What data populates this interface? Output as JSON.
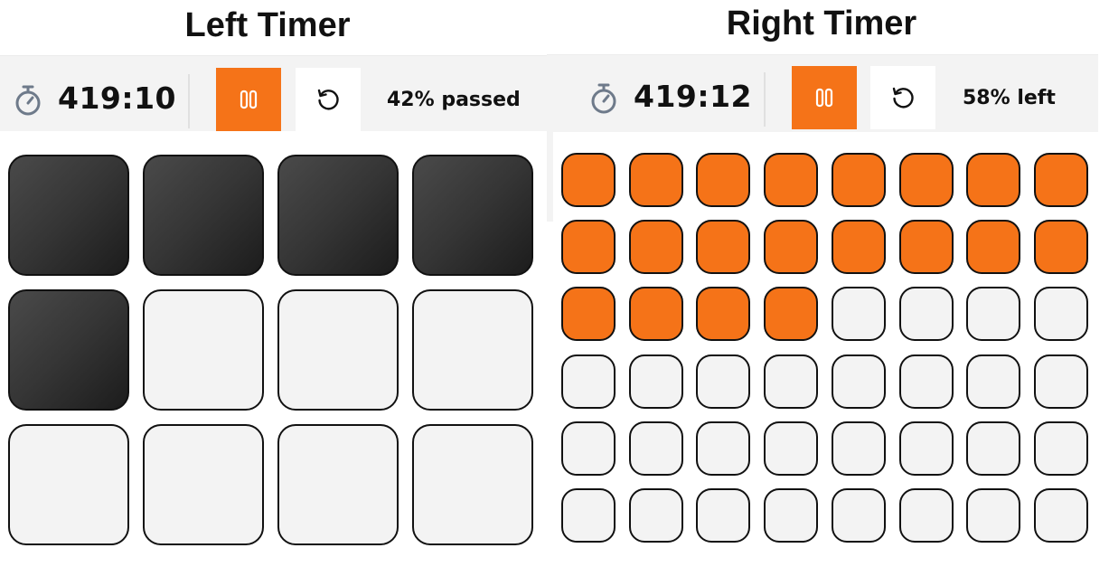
{
  "left_timer": {
    "title": "Left Timer",
    "time": "419:10",
    "status": "42% passed",
    "progress_percent": 42,
    "grid": {
      "rows": 3,
      "columns": 4,
      "total_cells": 12,
      "filled_cells": 5,
      "fill_style": "dark"
    }
  },
  "right_timer": {
    "title": "Right Timer",
    "time": "419:12",
    "status": "58% left",
    "progress_percent_left": 58,
    "grid": {
      "rows": 6,
      "columns": 8,
      "total_cells": 48,
      "filled_cells": 20,
      "fill_style": "orange"
    }
  },
  "icons": {
    "stopwatch": "stopwatch-icon",
    "pause": "pause-icon",
    "reset": "reset-icon"
  },
  "colors": {
    "accent": "#f57318",
    "dark_cell": "#333333",
    "empty_cell": "#f3f3f3",
    "toolbar_bg": "#f3f3f3"
  }
}
